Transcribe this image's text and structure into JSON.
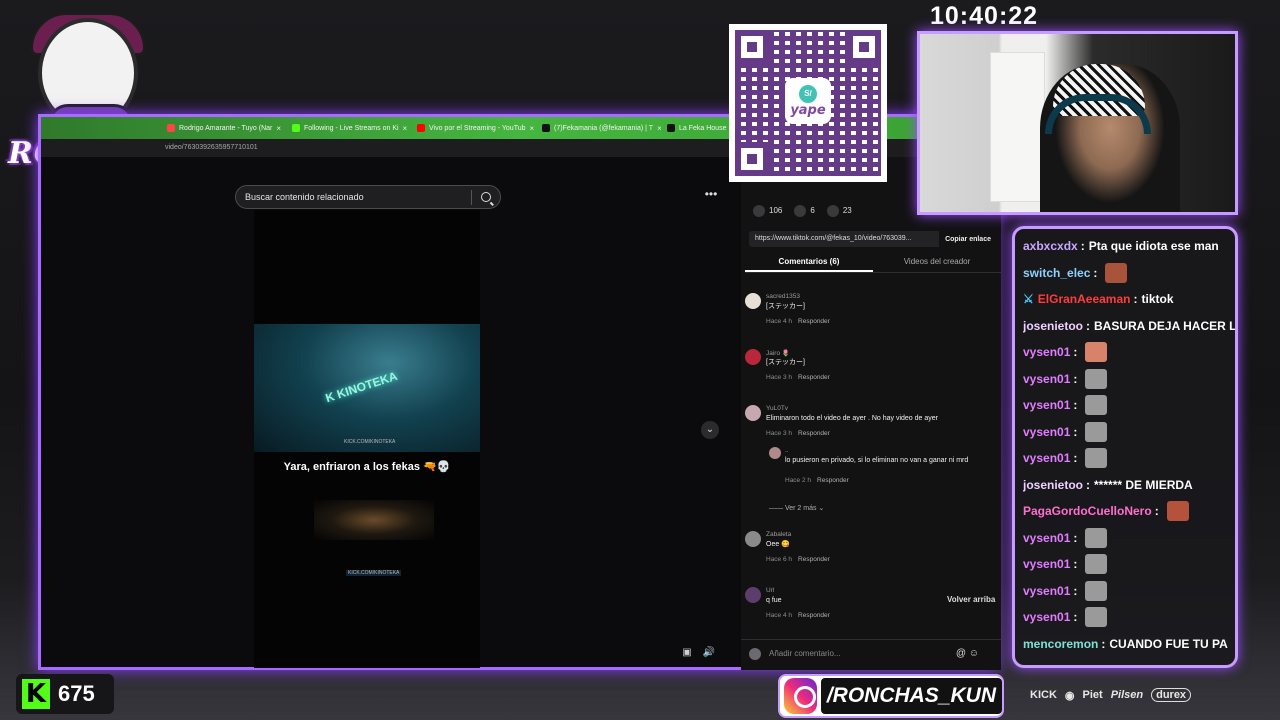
{
  "overlay": {
    "logo_text": "RONCHAS",
    "clock": "10:40:22",
    "kick_followers": "675",
    "instagram_handle": "/RONCHAS_KUN",
    "sponsors": [
      "KICK",
      "Piet",
      "Pilsen",
      "durex"
    ],
    "qr_brand": "yape",
    "qr_badge": "S/"
  },
  "browser": {
    "tabs": [
      {
        "label": "Rodrigo Amarante - Tuyo (Nar",
        "color": "#ff4444"
      },
      {
        "label": "Following - Live Streams on Ki",
        "color": "#53fc18"
      },
      {
        "label": "Vivo por el Streaming - YouTub",
        "color": "#ff0000"
      },
      {
        "label": "(7)Fekamania (@fekamania) | T",
        "color": "#111111"
      },
      {
        "label": "La Feka House 🏠 (@",
        "color": "#111111"
      }
    ],
    "url": "video/7630392635957710101",
    "search_placeholder": "Buscar contenido relacionado",
    "video_caption": "Yara, enfriaron a los fekas 🔫💀",
    "video_watermark": "KICK.COM/KINOTEKA",
    "video_logo": "K KINOTEKA"
  },
  "panel": {
    "likes": "106",
    "comments": "6",
    "saves": "23",
    "share_url": "https://www.tiktok.com/@fekas_10/video/763039...",
    "copy_label": "Copiar enlace",
    "tab_comments": "Comentarios (6)",
    "tab_creator": "Videos del creador",
    "reply_label": "Responder",
    "more_replies": "Ver 2 más",
    "back_top": "Volver arriba",
    "add_comment_placeholder": "Añadir comentario...",
    "comments_list": [
      {
        "user": "sacred1353",
        "text": "[ステッカー]",
        "time": "Hace 4 h"
      },
      {
        "user": "Jairo 🌷",
        "text": "[ステッカー]",
        "time": "Hace 3 h"
      },
      {
        "user": "YuL0Tv",
        "text": "Eliminaron todo el video de ayer . No hay video de ayer",
        "time": "Hace 3 h"
      },
      {
        "user": "Zabaleta",
        "text": "Oee 😋",
        "time": "Hace 6 h"
      },
      {
        "user": "Url",
        "text": "q fue",
        "time": "Hace 4 h"
      }
    ],
    "reply": {
      "user": "..",
      "text": "lo pusieron en privado, si lo eliminan no van a ganar ni mrd",
      "time": "Hace 2 h"
    }
  },
  "chat": [
    {
      "user": "axbxcxdx",
      "color": "#c9a8ff",
      "msg": "Pta que idiota ese man",
      "emote": ""
    },
    {
      "user": "switch_elec",
      "color": "#8fd0ff",
      "msg": "",
      "emote": "#a8543a"
    },
    {
      "user": "ElGranAeeaman",
      "color": "#ff3b3b",
      "msg": "tiktok",
      "emote": "",
      "badge": "sword"
    },
    {
      "user": "josenietoo",
      "color": "#f0d0ff",
      "msg": "BASURA DEJA HACER L",
      "emote": ""
    },
    {
      "user": "vysen01",
      "color": "#e27cff",
      "msg": "",
      "emote": "#d9826a"
    },
    {
      "user": "vysen01",
      "color": "#e27cff",
      "msg": "",
      "emote": "#9a9a9a"
    },
    {
      "user": "vysen01",
      "color": "#e27cff",
      "msg": "",
      "emote": "#9a9a9a"
    },
    {
      "user": "vysen01",
      "color": "#e27cff",
      "msg": "",
      "emote": "#9a9a9a"
    },
    {
      "user": "vysen01",
      "color": "#e27cff",
      "msg": "",
      "emote": "#9a9a9a"
    },
    {
      "user": "josenietoo",
      "color": "#f0d0ff",
      "msg": "****** DE MIERDA",
      "emote": ""
    },
    {
      "user": "PagaGordoCuelloNero",
      "color": "#ff6ecf",
      "msg": "",
      "emote": "#b5523c"
    },
    {
      "user": "vysen01",
      "color": "#e27cff",
      "msg": "",
      "emote": "#9a9a9a"
    },
    {
      "user": "vysen01",
      "color": "#e27cff",
      "msg": "",
      "emote": "#9a9a9a"
    },
    {
      "user": "vysen01",
      "color": "#e27cff",
      "msg": "",
      "emote": "#9a9a9a"
    },
    {
      "user": "vysen01",
      "color": "#e27cff",
      "msg": "",
      "emote": "#9a9a9a"
    },
    {
      "user": "mencoremon",
      "color": "#7fe1d6",
      "msg": "CUANDO FUE TU PA",
      "emote": ""
    }
  ]
}
